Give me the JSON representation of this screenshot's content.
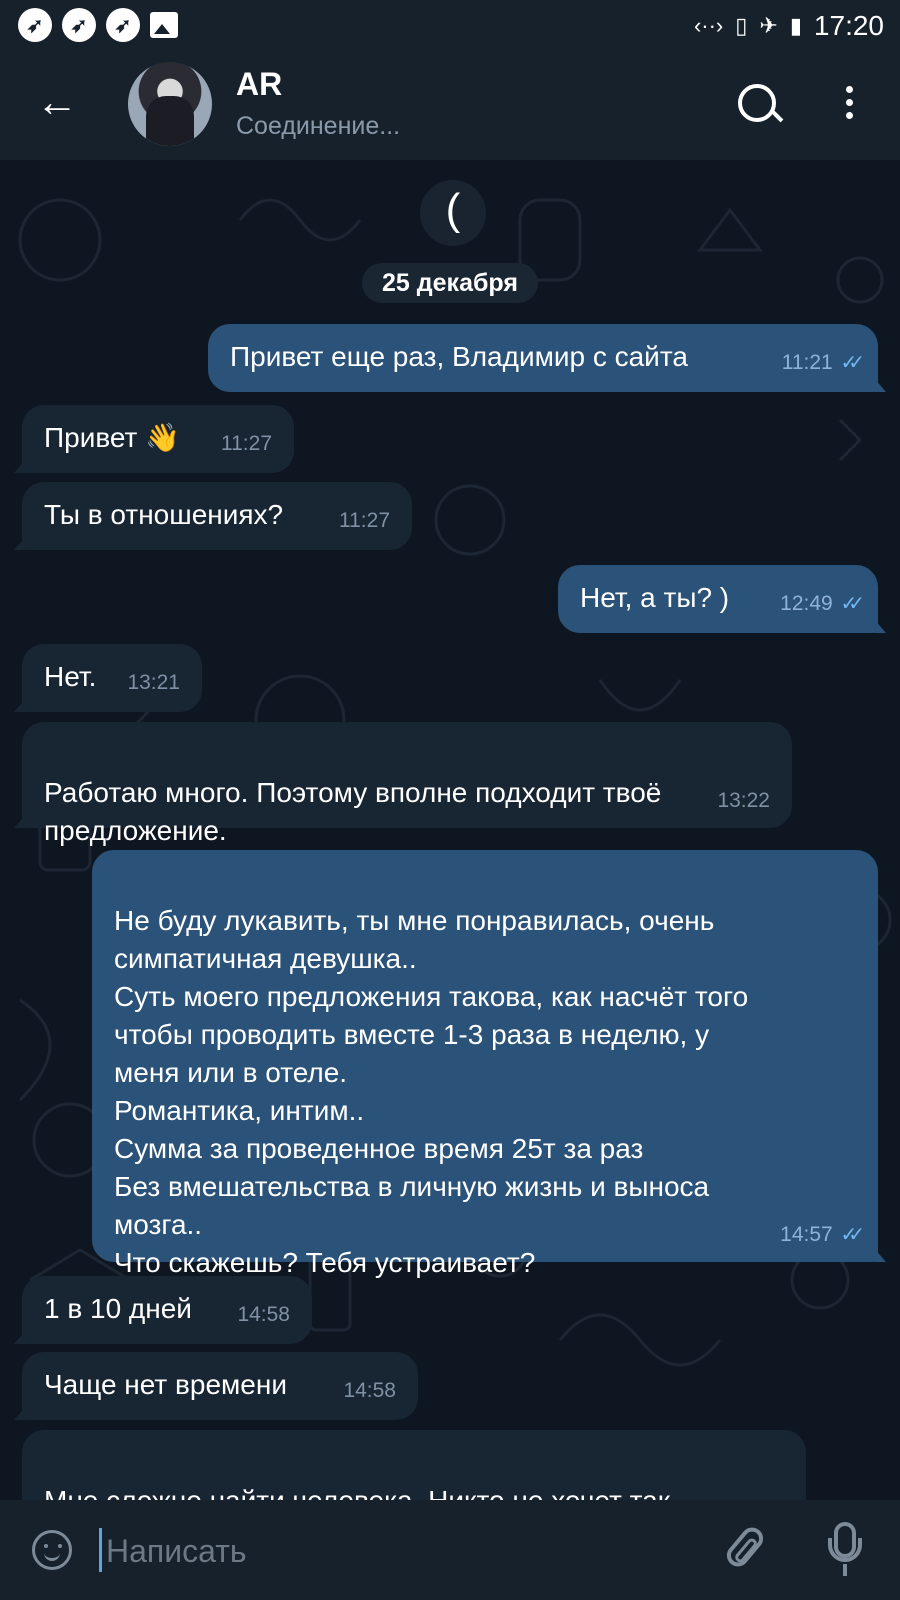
{
  "status_bar": {
    "notif_icons": [
      "telegram-icon",
      "telegram-icon",
      "telegram-icon",
      "image-icon"
    ],
    "time": "17:20",
    "icons": [
      "data-arrows-icon",
      "no-sim-icon",
      "airplane-icon",
      "battery-charging-icon"
    ]
  },
  "header": {
    "title": "AR",
    "status": "Соединение...",
    "back_icon": "arrow-back-icon",
    "search_icon": "search-icon",
    "menu_icon": "more-vertical-icon"
  },
  "chat": {
    "date_chip": "25 декабря",
    "messages": [
      {
        "dir": "out",
        "text": "Привет еще раз, Владимир с сайта",
        "time": "11:21",
        "read": true
      },
      {
        "dir": "in",
        "text": "Привет 👋",
        "time": "11:27"
      },
      {
        "dir": "in",
        "text": "Ты в отношениях?",
        "time": "11:27"
      },
      {
        "dir": "out",
        "text": "Нет, а ты? )",
        "time": "12:49",
        "read": true
      },
      {
        "dir": "in",
        "text": "Нет.",
        "time": "13:21"
      },
      {
        "dir": "in",
        "text": "Работаю много.  Поэтому вполне подходит твоё\nпредложение.",
        "time": "13:22"
      },
      {
        "dir": "out",
        "text": "Не буду лукавить, ты мне понравилась, очень\nсимпатичная девушка..\nСуть моего предложения такова, как насчёт того\nчтобы проводить вместе 1-3 раза в неделю, у\nменя или в отеле.\nРомантика, интим..\nСумма за проведенное время 25т за раз\nБез вмешательства в личную жизнь и выноса\nмозга..\nЧто скажешь? Тебя устраивает?",
        "time": "14:57",
        "read": true
      },
      {
        "dir": "in",
        "text": "1 в 10 дней",
        "time": "14:58"
      },
      {
        "dir": "in",
        "text": "Чаще нет времени",
        "time": "14:58"
      },
      {
        "dir": "in",
        "text": "Мне сложно найти человека.  Никто не хочет так\nвстречаться",
        "time": ""
      }
    ]
  },
  "composer": {
    "placeholder": "Написать",
    "emoji_icon": "emoji-icon",
    "attach_icon": "paperclip-icon",
    "mic_icon": "microphone-icon"
  },
  "colors": {
    "background": "#0e1621",
    "header": "#17212b",
    "bubble_in": "#182533",
    "bubble_out": "#2b5278",
    "accent": "#5ea5e0"
  }
}
